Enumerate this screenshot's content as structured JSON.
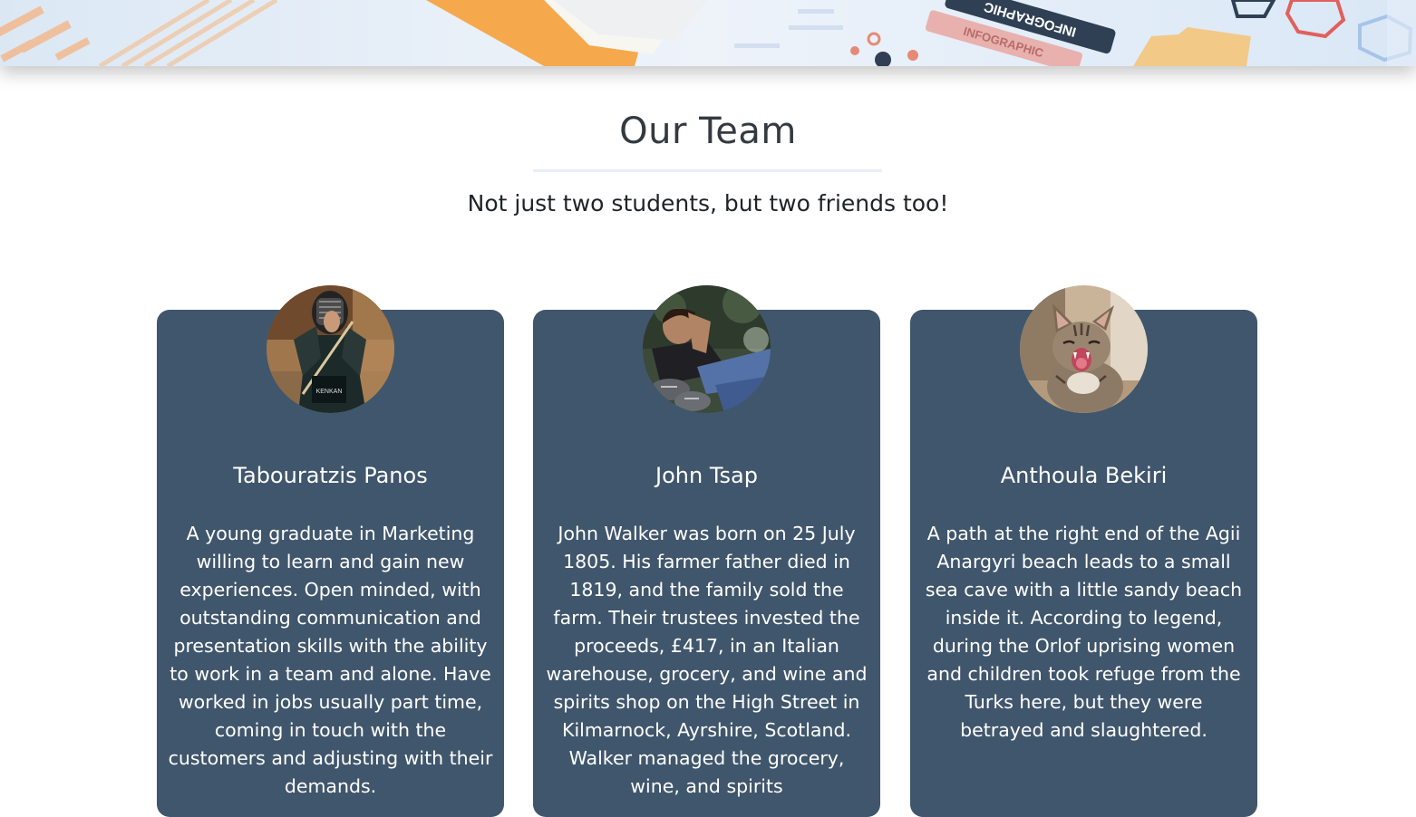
{
  "hero": {
    "banner_text": "INFOGRAPHIC",
    "banner_text_mirror": "INFOGRAPHIC"
  },
  "section": {
    "title": "Our Team",
    "subtitle": "Not just two students, but two friends too!"
  },
  "team": [
    {
      "name": "Tabouratzis Panos",
      "bio": "A young graduate in Marketing willing to learn and gain new experiences. Open minded, with outstanding communication and presentation skills with the ability to work in a team and alone. Have worked in jobs usually part time, coming in touch with the customers and adjusting with their demands."
    },
    {
      "name": "John Tsap",
      "bio": "John Walker was born on 25 July 1805. His farmer father died in 1819, and the family sold the farm. Their trustees invested the proceeds, £417, in an Italian warehouse, grocery, and wine and spirits shop on the High Street in Kilmarnock, Ayrshire, Scotland. Walker managed the grocery, wine, and spirits"
    },
    {
      "name": "Anthoula Bekiri",
      "bio": "A path at the right end of the Agii Anargyri beach leads to a small sea cave with a little sandy beach inside it. According to legend, during the Orlof uprising women and children took refuge from the Turks here, but they were betrayed and slaughtered."
    }
  ],
  "colors": {
    "card_background": "#40566c",
    "title_text": "#333a40",
    "rule": "#e6eef8"
  }
}
